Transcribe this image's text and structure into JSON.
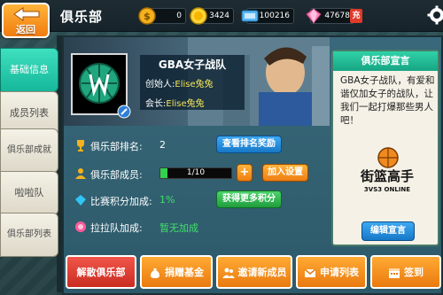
{
  "app": {
    "page_title": "俱乐部",
    "back_label": "返回"
  },
  "resources": {
    "gold": "0",
    "coins": "3424",
    "tickets": "100216",
    "diamonds": "47678",
    "recharge_label": "充"
  },
  "tabs": [
    {
      "label": "基础信息",
      "active": true
    },
    {
      "label": "成员列表",
      "active": false
    },
    {
      "label": "俱乐部成就",
      "active": false
    },
    {
      "label": "啦啦队",
      "active": false
    },
    {
      "label": "俱乐部列表",
      "active": false
    }
  ],
  "club": {
    "name": "GBA女子战队",
    "founder_label": "创始人:",
    "founder": "Elise兔兔",
    "president_label": "会长:",
    "president": "Elise兔兔"
  },
  "announcement": {
    "title": "俱乐部宣言",
    "text": "GBA女子战队，有爱和谐仅加女子的战队，让我们一起打爆那些男人吧！",
    "edit_label": "编辑宣言",
    "brand_main": "街篮高手",
    "brand_sub": "3VS3 ONLINE"
  },
  "stats": {
    "rank_label": "俱乐部排名:",
    "rank_value": "2",
    "rank_button": "查看排名奖励",
    "members_label": "俱乐部成员:",
    "members_progress": "1/10",
    "members_fraction": 0.1,
    "add_member_symbol": "+",
    "join_settings_button": "加入设置",
    "points_label": "比赛积分加成:",
    "points_value": "1%",
    "points_button": "获得更多积分",
    "cheer_label": "拉拉队加成:",
    "cheer_value": "暂无加成"
  },
  "bottom": {
    "dissolve": "解散俱乐部",
    "donate": "捐赠基金",
    "invite": "邀请新成员",
    "applications": "申请列表",
    "signin": "签到"
  }
}
